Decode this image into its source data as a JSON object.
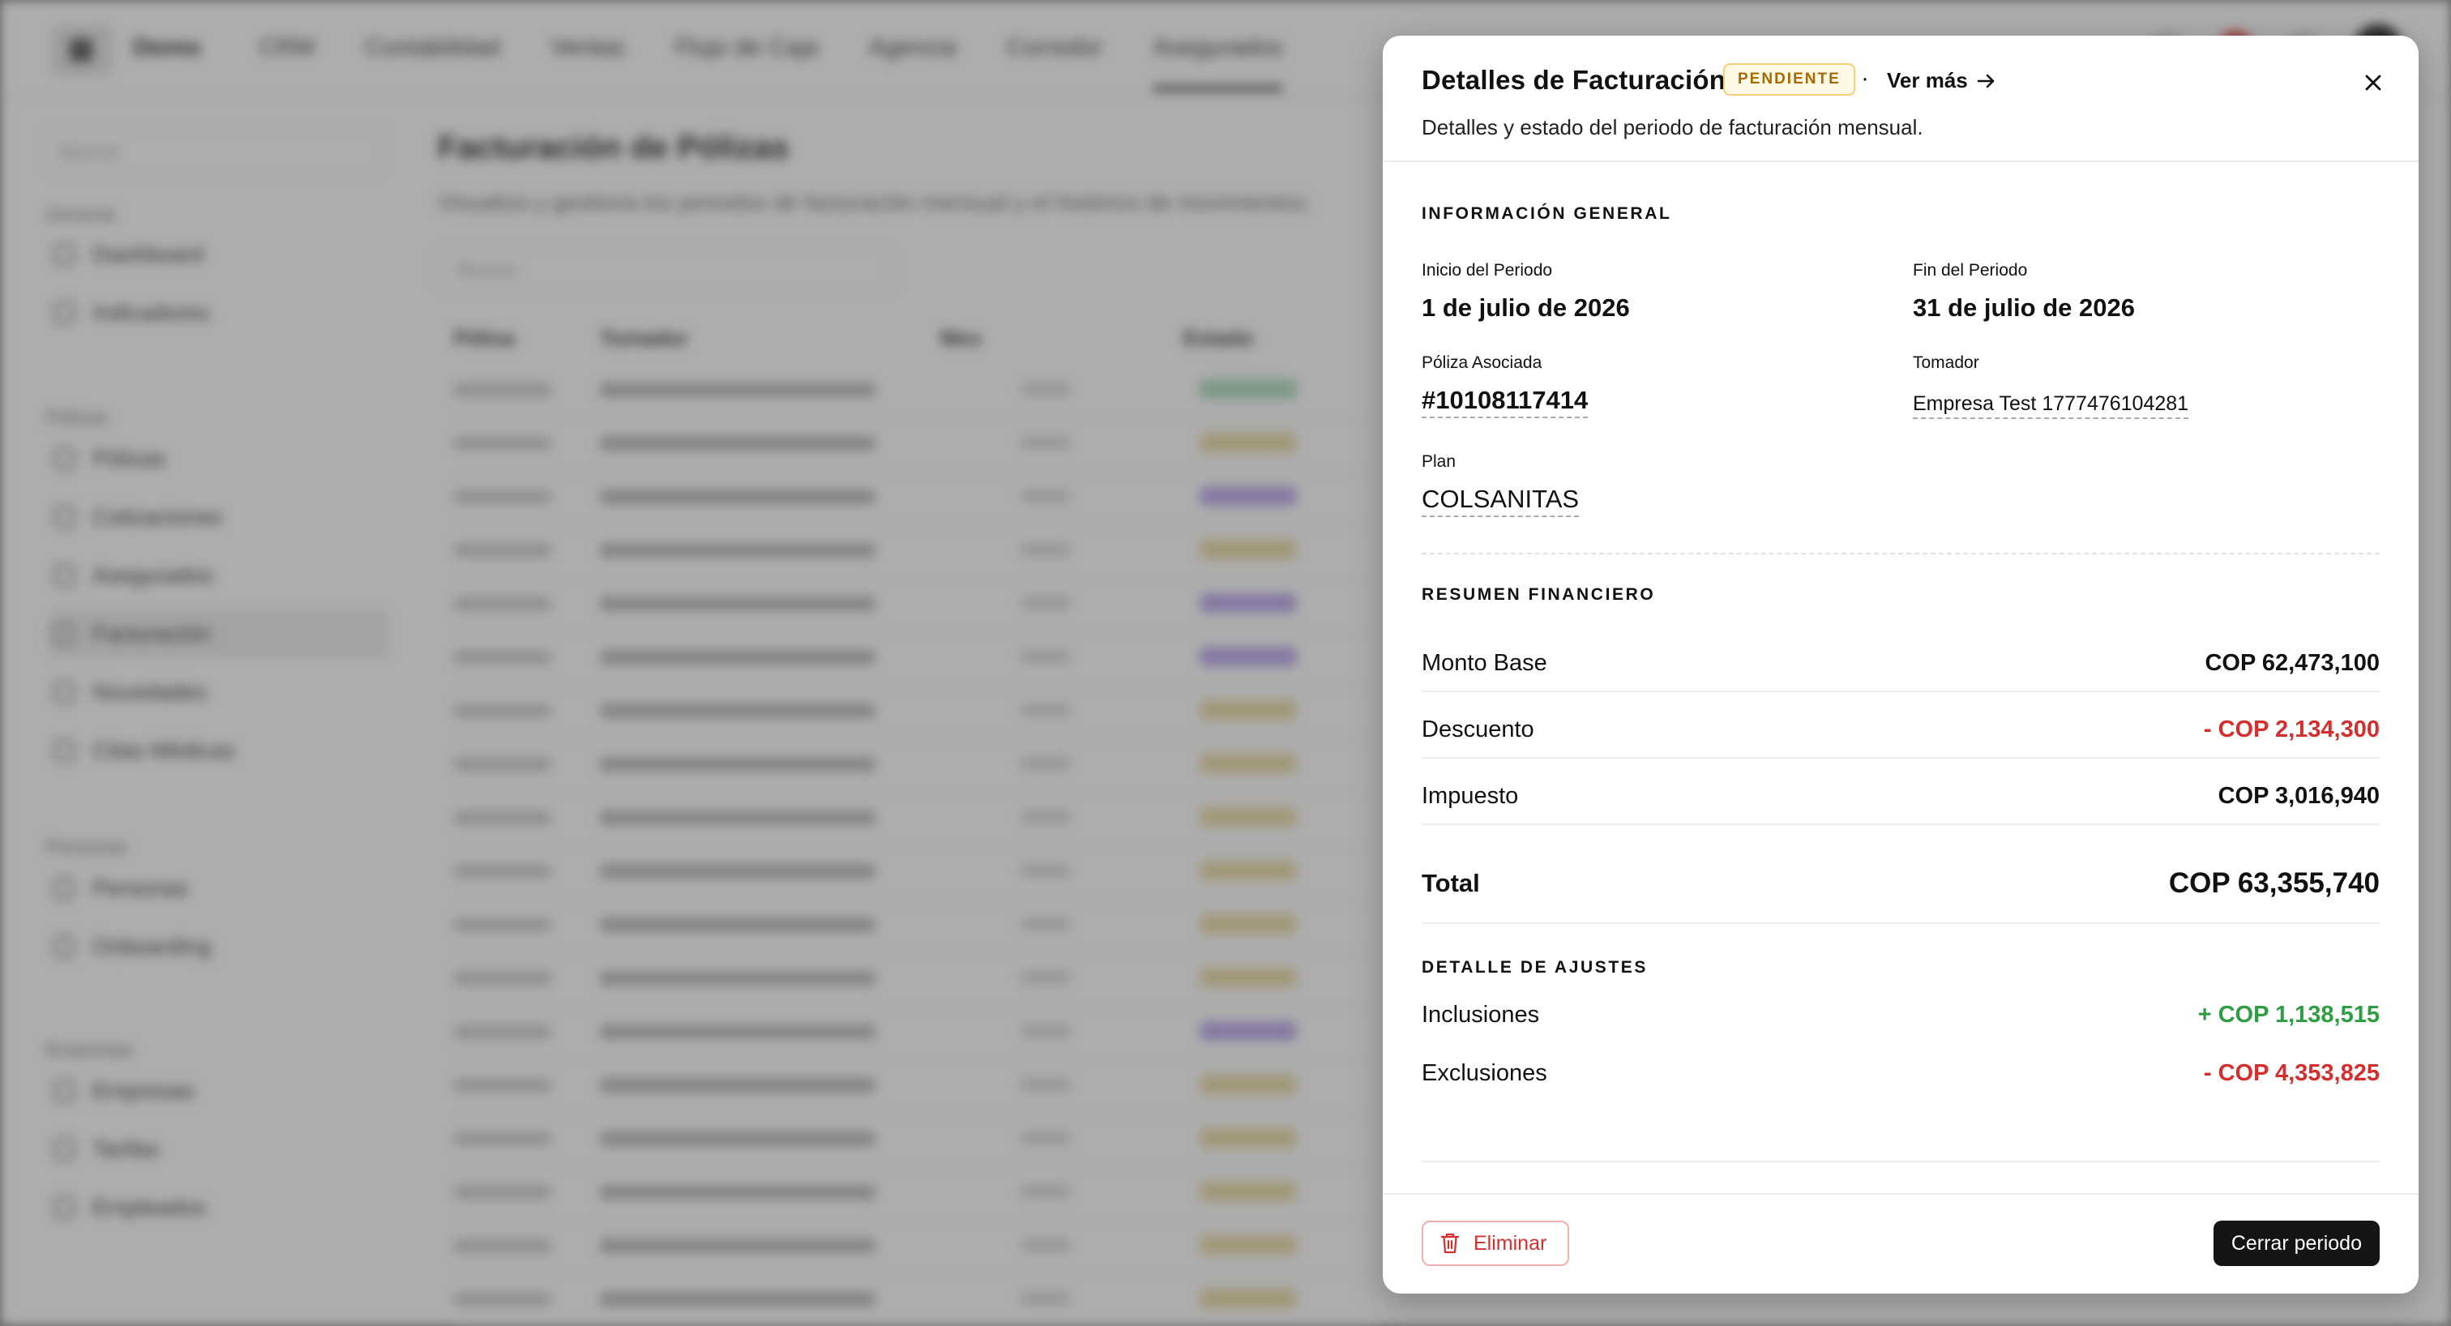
{
  "background": {
    "app_name": "Demo",
    "nav": [
      "CRM",
      "Contabilidad",
      "Ventas",
      "Flujo de Caja",
      "Agencia",
      "Corredor",
      "Asegurados"
    ],
    "sidebar_search": "Buscar",
    "sidebar_groups": [
      {
        "title": "General",
        "items": [
          "Dashboard",
          "Indicadores"
        ]
      },
      {
        "title": "Pólizas",
        "items": [
          "Pólizas",
          "Cotizaciones",
          "Asegurados",
          "Facturación",
          "Novedades",
          "Citas Médicas"
        ]
      },
      {
        "title": "Personas",
        "items": [
          "Personas",
          "Onboarding"
        ]
      },
      {
        "title": "Empresas",
        "items": [
          "Empresas",
          "Tarifas",
          "Empleados"
        ]
      }
    ],
    "page_title": "Facturación de Pólizas",
    "page_subtitle": "Visualiza y gestiona los periodos de facturación mensual y el histórico de movimientos.",
    "table_search": "Buscar",
    "table_headers": [
      "Póliza",
      "Tomador",
      "Mes",
      "Estado"
    ]
  },
  "modal": {
    "title": "Detalles de Facturación",
    "status_badge": "PENDIENTE",
    "separator": "·",
    "see_more": "Ver más",
    "subtitle": "Detalles y estado del periodo de facturación mensual.",
    "general": {
      "section_title": "INFORMACIÓN GENERAL",
      "period_start_label": "Inicio del Periodo",
      "period_start": "1 de julio de 2026",
      "period_end_label": "Fin del Periodo",
      "period_end": "31 de julio de 2026",
      "policy_label": "Póliza Asociada",
      "policy": "#10108117414",
      "holder_label": "Tomador",
      "holder": "Empresa Test 1777476104281",
      "plan_label": "Plan",
      "plan": "COLSANITAS"
    },
    "financial": {
      "section_title": "RESUMEN FINANCIERO",
      "base_label": "Monto Base",
      "base": "COP 62,473,100",
      "discount_label": "Descuento",
      "discount": "- COP 2,134,300",
      "tax_label": "Impuesto",
      "tax": "COP 3,016,940",
      "total_label": "Total",
      "total": "COP 63,355,740"
    },
    "adjustments": {
      "section_title": "DETALLE DE AJUSTES",
      "inclusions_label": "Inclusiones",
      "inclusions": "+ COP 1,138,515",
      "exclusions_label": "Exclusiones",
      "exclusions": "- COP 4,353,825"
    },
    "footer": {
      "delete_label": "Eliminar",
      "close_period_label": "Cerrar periodo"
    }
  },
  "colors": {
    "badge_text": "#a66a00",
    "negative": "#d32f2f",
    "positive": "#2e9d44",
    "primary_button": "#151515"
  }
}
